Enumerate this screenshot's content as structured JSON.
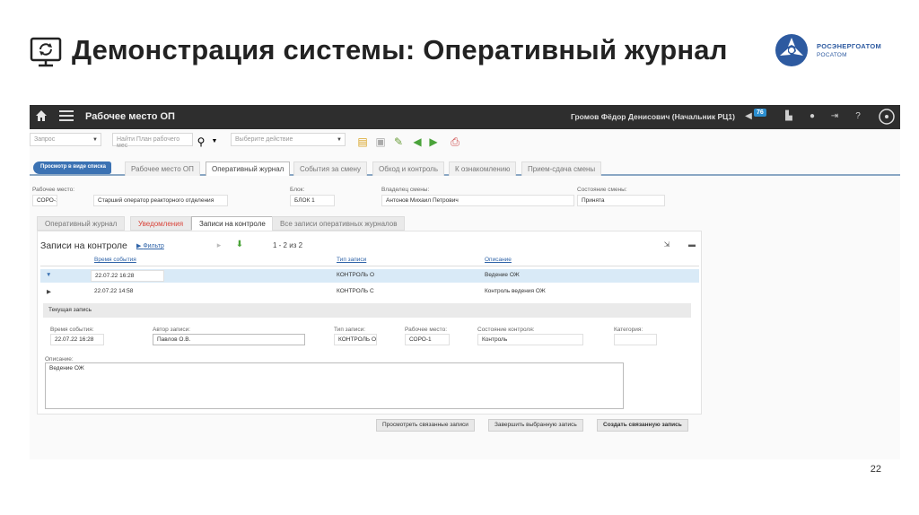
{
  "slide": {
    "title": "Демонстрация системы: Оперативный журнал",
    "logo_line1": "РОСЭНЕРГОАТОМ",
    "logo_line2": "РОСАТОМ",
    "page_number": "22"
  },
  "topbar": {
    "app_title": "Рабочее место ОП",
    "user": "Громов Фёдор Денисович (Начальник РЦ1)",
    "badge": "76"
  },
  "toolbar": {
    "request_placeholder": "Запрос",
    "find_placeholder": "Найти План рабочего мес",
    "action_placeholder": "Выберите действие"
  },
  "tabs": {
    "back": "Просмотр в виде списка",
    "items": [
      "Рабочее место ОП",
      "Оперативный журнал",
      "События за смену",
      "Обход и контроль",
      "К ознакомлению",
      "Прием-сдача смены"
    ]
  },
  "workplace": {
    "workplace_label": "Рабочее место:",
    "code": "СОРО-1",
    "name": "Старший оператор реакторного отделения",
    "block_label": "Блок:",
    "block": "БЛОК 1",
    "owner_label": "Владелец смены:",
    "owner": "Антонов Михаил Петрович",
    "state_label": "Состояние смены:",
    "state": "Принята"
  },
  "subtabs": [
    "Оперативный журнал",
    "Уведомления",
    "Записи на контроле",
    "Все записи оперативных журналов"
  ],
  "records": {
    "title": "Записи на контроле",
    "filter": "Фильтр",
    "pager": "1 - 2 из 2",
    "headers": [
      "Время события",
      "Тип записи",
      "Описание"
    ],
    "rows": [
      {
        "time": "22.07.22 16:28",
        "type": "КОНТРОЛЬ О",
        "desc": "Ведение ОЖ"
      },
      {
        "time": "22.07.22 14:58",
        "type": "КОНТРОЛЬ С",
        "desc": "Контроль ведения ОЖ"
      }
    ]
  },
  "current": {
    "title": "Текущая запись",
    "time_label": "Время события:",
    "time": "22.07.22 16:28",
    "author_label": "Автор записи:",
    "author": "Павлов О.В.",
    "type_label": "Тип записи:",
    "type": "КОНТРОЛЬ О",
    "workplace_label": "Рабочее место:",
    "workplace": "СОРО-1",
    "control_label": "Состояние контроля:",
    "control": "Контроль",
    "category_label": "Категория:",
    "category": "",
    "desc_label": "Описание:",
    "desc": "Ведение ОЖ"
  },
  "buttons": {
    "view_linked": "Просмотреть связанные записи",
    "finish_selected": "Завершить выбранную запись",
    "create_linked": "Создать связанную запись"
  },
  "colors": {
    "topbar": "#2e2e2e",
    "accent": "#3b72b3",
    "selected_row": "#d9eaf7"
  }
}
